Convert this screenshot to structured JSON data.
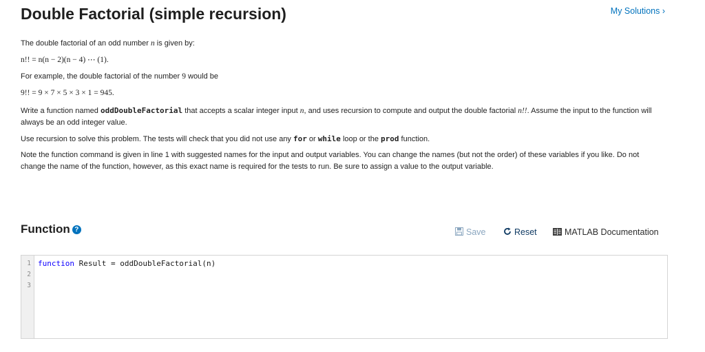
{
  "header": {
    "title": "Double Factorial (simple recursion)",
    "my_solutions": "My Solutions ›"
  },
  "description": {
    "intro_before": "The double factorial of an odd number ",
    "intro_var": "n",
    "intro_after": " is given by:",
    "formula1": "n!! = n(n − 2)(n − 4) ⋯ (1).",
    "example_before": "For example, the double factorial of the number ",
    "example_num": "9",
    "example_after": " would be",
    "formula2": "9!! = 9 × 7 × 5 × 3 × 1 = 945.",
    "write_before": "Write a function named ",
    "write_fn": "oddDoubleFactorial",
    "write_mid1": " that accepts a scalar integer input ",
    "write_var": "n",
    "write_mid2": ", and uses recursion to compute and output the double factorial ",
    "write_expr": "n!!",
    "write_after": ". Assume the input to the function will always be an odd integer value.",
    "rec_before": "Use recursion to solve this problem.  The tests will check that you did not use any ",
    "rec_for": "for",
    "rec_or": " or ",
    "rec_while": "while",
    "rec_mid": " loop or the ",
    "rec_prod": "prod",
    "rec_after": " function.",
    "note": "Note the function command is given in line 1 with suggested names for the input and output variables.  You can change the names (but not the order) of these variables if you like.  Do not change the name of the function, however, as this exact name is required for the tests to run.  Be sure to assign a value to the output variable."
  },
  "function_section": {
    "title": "Function",
    "save_label": "Save",
    "reset_label": "Reset",
    "docs_label": "MATLAB Documentation"
  },
  "editor": {
    "line_numbers": [
      "1",
      "2",
      "3"
    ],
    "keyword": "function",
    "signature": " Result = oddDoubleFactorial(n)"
  },
  "colors": {
    "link": "#0072bd",
    "save_disabled": "#8aa6bf",
    "keyword": "#0e00ff"
  }
}
